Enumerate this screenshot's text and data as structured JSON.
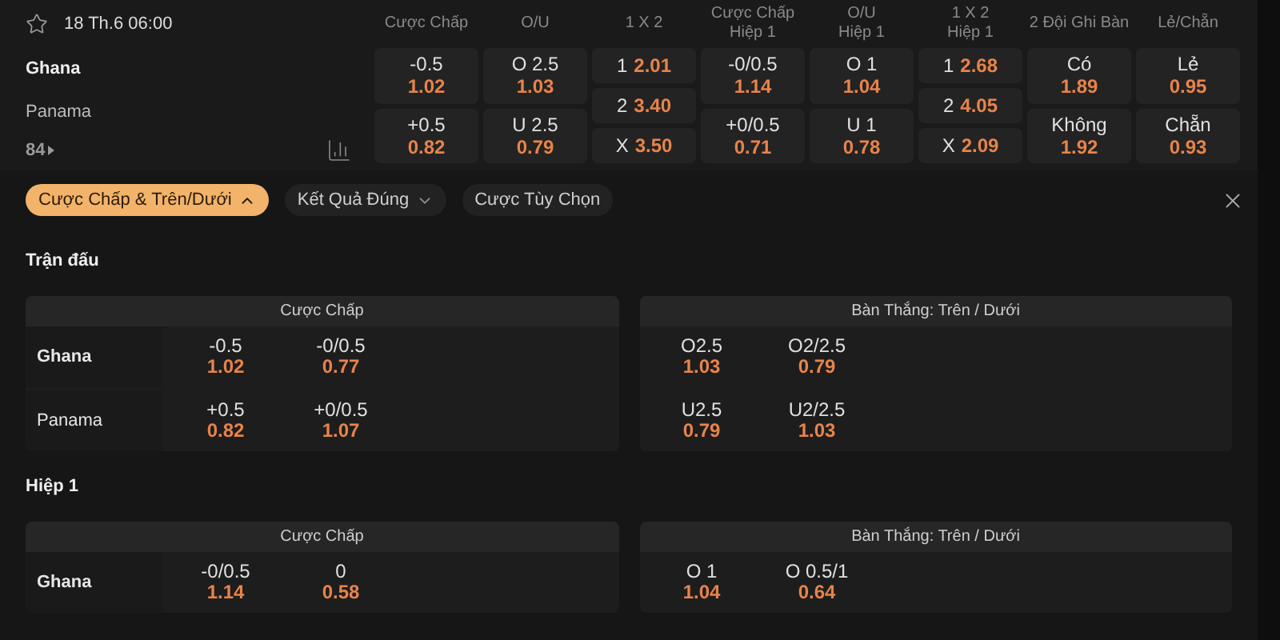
{
  "match": {
    "time": "18 Th.6 06:00",
    "teams": [
      "Ghana",
      "Panama"
    ],
    "more": "84",
    "markets": [
      {
        "header": [
          "Cược Chấp"
        ],
        "kind": "pair",
        "cells": [
          {
            "label": "-0.5",
            "odds": "1.02"
          },
          {
            "label": "+0.5",
            "odds": "0.82"
          }
        ]
      },
      {
        "header": [
          "O/U"
        ],
        "kind": "pair",
        "cells": [
          {
            "label": "O 2.5",
            "odds": "1.03"
          },
          {
            "label": "U 2.5",
            "odds": "0.79"
          }
        ]
      },
      {
        "header": [
          "1 X 2"
        ],
        "kind": "triple",
        "cells": [
          {
            "label": "1",
            "odds": "2.01"
          },
          {
            "label": "2",
            "odds": "3.40"
          },
          {
            "label": "X",
            "odds": "3.50"
          }
        ]
      },
      {
        "header": [
          "Cược Chấp",
          "Hiệp 1"
        ],
        "kind": "pair",
        "cells": [
          {
            "label": "-0/0.5",
            "odds": "1.14"
          },
          {
            "label": "+0/0.5",
            "odds": "0.71"
          }
        ]
      },
      {
        "header": [
          "O/U",
          "Hiệp 1"
        ],
        "kind": "pair",
        "cells": [
          {
            "label": "O 1",
            "odds": "1.04"
          },
          {
            "label": "U 1",
            "odds": "0.78"
          }
        ]
      },
      {
        "header": [
          "1 X 2",
          "Hiệp 1"
        ],
        "kind": "triple",
        "cells": [
          {
            "label": "1",
            "odds": "2.68"
          },
          {
            "label": "2",
            "odds": "4.05"
          },
          {
            "label": "X",
            "odds": "2.09"
          }
        ]
      },
      {
        "header": [
          "2 Đội Ghi Bàn"
        ],
        "kind": "pair",
        "cells": [
          {
            "label": "Có",
            "odds": "1.89"
          },
          {
            "label": "Không",
            "odds": "1.92"
          }
        ]
      },
      {
        "header": [
          "Lẻ/Chẵn"
        ],
        "kind": "pair",
        "cells": [
          {
            "label": "Lẻ",
            "odds": "0.95"
          },
          {
            "label": "Chẵn",
            "odds": "0.93"
          }
        ]
      }
    ]
  },
  "filters": [
    {
      "label": "Cược Chấp & Trên/Dưới",
      "selected": true,
      "expanded": true
    },
    {
      "label": "Kết Quả Đúng",
      "selected": false,
      "expanded": false
    },
    {
      "label": "Cược Tùy Chọn",
      "selected": false
    }
  ],
  "sections": [
    {
      "title": "Trận đấu",
      "panels": [
        {
          "title": "Cược Chấp",
          "kind": "teams",
          "rows": [
            {
              "team": "Ghana",
              "cells": [
                {
                  "line": "-0.5",
                  "odds": "1.02"
                },
                {
                  "line": "-0/0.5",
                  "odds": "0.77"
                }
              ]
            },
            {
              "team": "Panama",
              "cells": [
                {
                  "line": "+0.5",
                  "odds": "0.82"
                },
                {
                  "line": "+0/0.5",
                  "odds": "1.07"
                }
              ]
            }
          ]
        },
        {
          "title": "Bàn Thắng: Trên / Dưới",
          "kind": "plain",
          "rows": [
            {
              "cells": [
                {
                  "line": "O2.5",
                  "odds": "1.03"
                },
                {
                  "line": "O2/2.5",
                  "odds": "0.79"
                }
              ]
            },
            {
              "cells": [
                {
                  "line": "U2.5",
                  "odds": "0.79"
                },
                {
                  "line": "U2/2.5",
                  "odds": "1.03"
                }
              ]
            }
          ]
        }
      ]
    },
    {
      "title": "Hiệp 1",
      "panels": [
        {
          "title": "Cược Chấp",
          "kind": "teams",
          "rows": [
            {
              "team": "Ghana",
              "cells": [
                {
                  "line": "-0/0.5",
                  "odds": "1.14"
                },
                {
                  "line": "0",
                  "odds": "0.58"
                }
              ]
            }
          ]
        },
        {
          "title": "Bàn Thắng: Trên / Dưới",
          "kind": "plain",
          "rows": [
            {
              "cells": [
                {
                  "line": "O 1",
                  "odds": "1.04"
                },
                {
                  "line": "O 0.5/1",
                  "odds": "0.64"
                }
              ]
            }
          ]
        }
      ]
    }
  ]
}
